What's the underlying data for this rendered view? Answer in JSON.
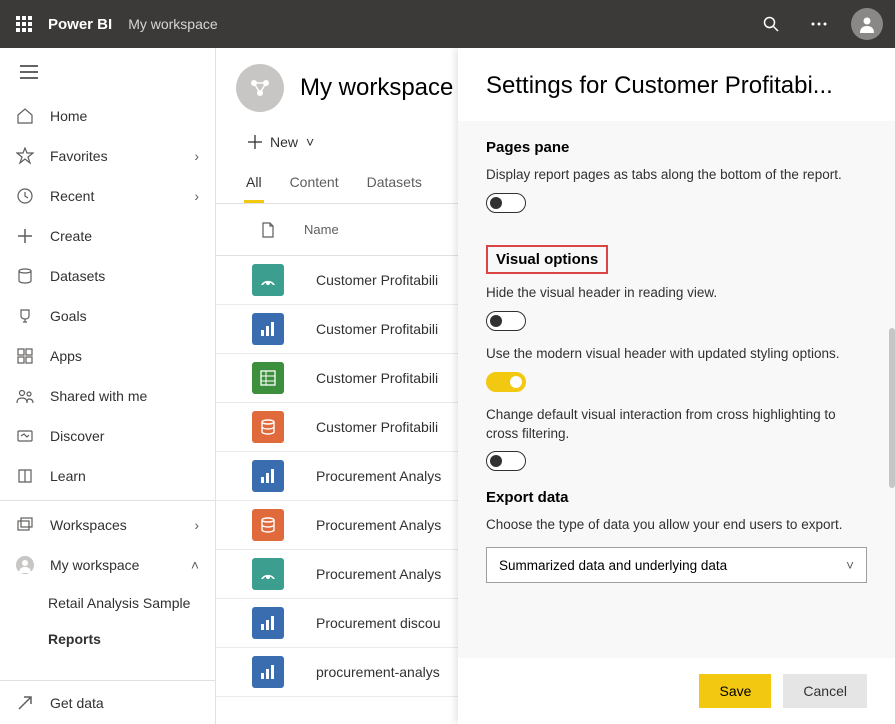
{
  "topbar": {
    "brand": "Power BI",
    "context": "My workspace"
  },
  "sidebar": {
    "items": [
      {
        "label": "Home",
        "icon": "home"
      },
      {
        "label": "Favorites",
        "icon": "star",
        "chevron": true
      },
      {
        "label": "Recent",
        "icon": "clock",
        "chevron": true
      },
      {
        "label": "Create",
        "icon": "plus"
      },
      {
        "label": "Datasets",
        "icon": "data"
      },
      {
        "label": "Goals",
        "icon": "trophy"
      },
      {
        "label": "Apps",
        "icon": "apps"
      },
      {
        "label": "Shared with me",
        "icon": "people"
      },
      {
        "label": "Discover",
        "icon": "discover"
      },
      {
        "label": "Learn",
        "icon": "book"
      }
    ],
    "workspaces_label": "Workspaces",
    "my_workspace_label": "My workspace",
    "sub_items": [
      {
        "label": "Retail Analysis Sample",
        "active": false
      },
      {
        "label": "Reports",
        "active": true
      }
    ],
    "get_data_label": "Get data"
  },
  "workspace": {
    "title": "My workspace",
    "new_label": "New",
    "tabs": [
      {
        "label": "All",
        "active": true
      },
      {
        "label": "Content",
        "active": false
      },
      {
        "label": "Datasets",
        "active": false
      }
    ],
    "columns": {
      "name": "Name"
    },
    "items": [
      {
        "name": "Customer Profitabili",
        "color": "teal",
        "icon": "gauge"
      },
      {
        "name": "Customer Profitabili",
        "color": "blue",
        "icon": "bars"
      },
      {
        "name": "Customer Profitabili",
        "color": "green",
        "icon": "sheet"
      },
      {
        "name": "Customer Profitabili",
        "color": "orange",
        "icon": "db"
      },
      {
        "name": "Procurement Analys",
        "color": "blue",
        "icon": "bars"
      },
      {
        "name": "Procurement Analys",
        "color": "orange",
        "icon": "db"
      },
      {
        "name": "Procurement Analys",
        "color": "teal",
        "icon": "gauge"
      },
      {
        "name": "Procurement discou",
        "color": "blue",
        "icon": "bars"
      },
      {
        "name": "procurement-analys",
        "color": "blue",
        "icon": "bars"
      }
    ]
  },
  "settings": {
    "title": "Settings for Customer Profitabi...",
    "sections": {
      "pages_pane": {
        "title": "Pages pane",
        "desc": "Display report pages as tabs along the bottom of the report.",
        "on": false
      },
      "visual_options": {
        "title": "Visual options",
        "hide_header_desc": "Hide the visual header in reading view.",
        "hide_header_on": false,
        "modern_header_desc": "Use the modern visual header with updated styling options.",
        "modern_header_on": true,
        "cross_filter_desc": "Change default visual interaction from cross highlighting to cross filtering.",
        "cross_filter_on": false
      },
      "export": {
        "title": "Export data",
        "desc": "Choose the type of data you allow your end users to export.",
        "value": "Summarized data and underlying data"
      }
    },
    "save_label": "Save",
    "cancel_label": "Cancel"
  }
}
